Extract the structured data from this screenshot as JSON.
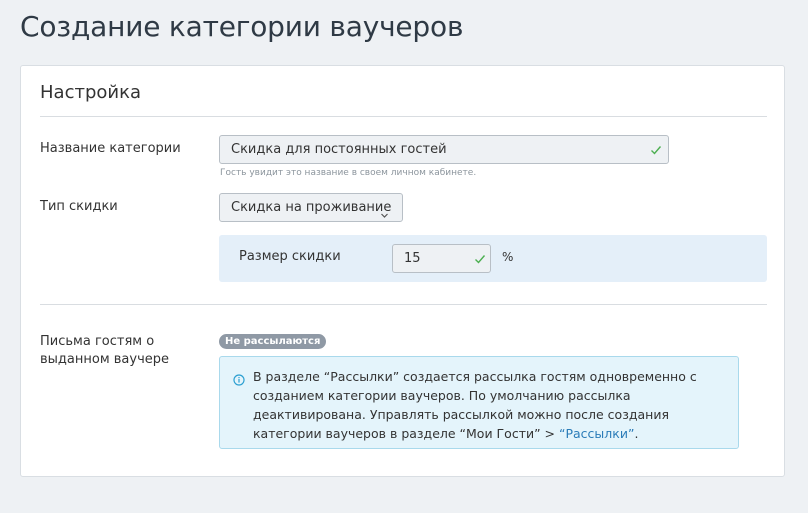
{
  "page": {
    "title": "Создание категории ваучеров"
  },
  "settings": {
    "title": "Настройка",
    "category_name": {
      "label": "Название категории",
      "value": "Скидка для постоянных гостей",
      "hint": "Гость увидит это название в своем личном кабинете."
    },
    "discount_type": {
      "label": "Тип скидки",
      "selected": "Скидка на проживание"
    },
    "discount_size": {
      "label": "Размер скидки",
      "value": "15",
      "unit": "%"
    },
    "letters": {
      "label": "Письма гостям о выданном ваучере",
      "badge": "Не рассылаются",
      "info_text_part1": "В разделе “Рассылки” создается рассылка гостям одновременно с созданием категории ваучеров. По умолчанию рассылка деактивирована. Управлять рассылкой можно после создания категории ваучеров в разделе “Мои Гости” > ",
      "info_link": "“Рассылки”",
      "info_text_part2": "."
    }
  },
  "colors": {
    "accent_link": "#2b7cb8",
    "check": "#4caf50",
    "panel_bg": "#e4eff9",
    "info_bg": "#e4f4fb",
    "badge_bg": "#8f99a5"
  },
  "icons": [
    "check-icon",
    "chevron-down-icon",
    "info-icon"
  ]
}
